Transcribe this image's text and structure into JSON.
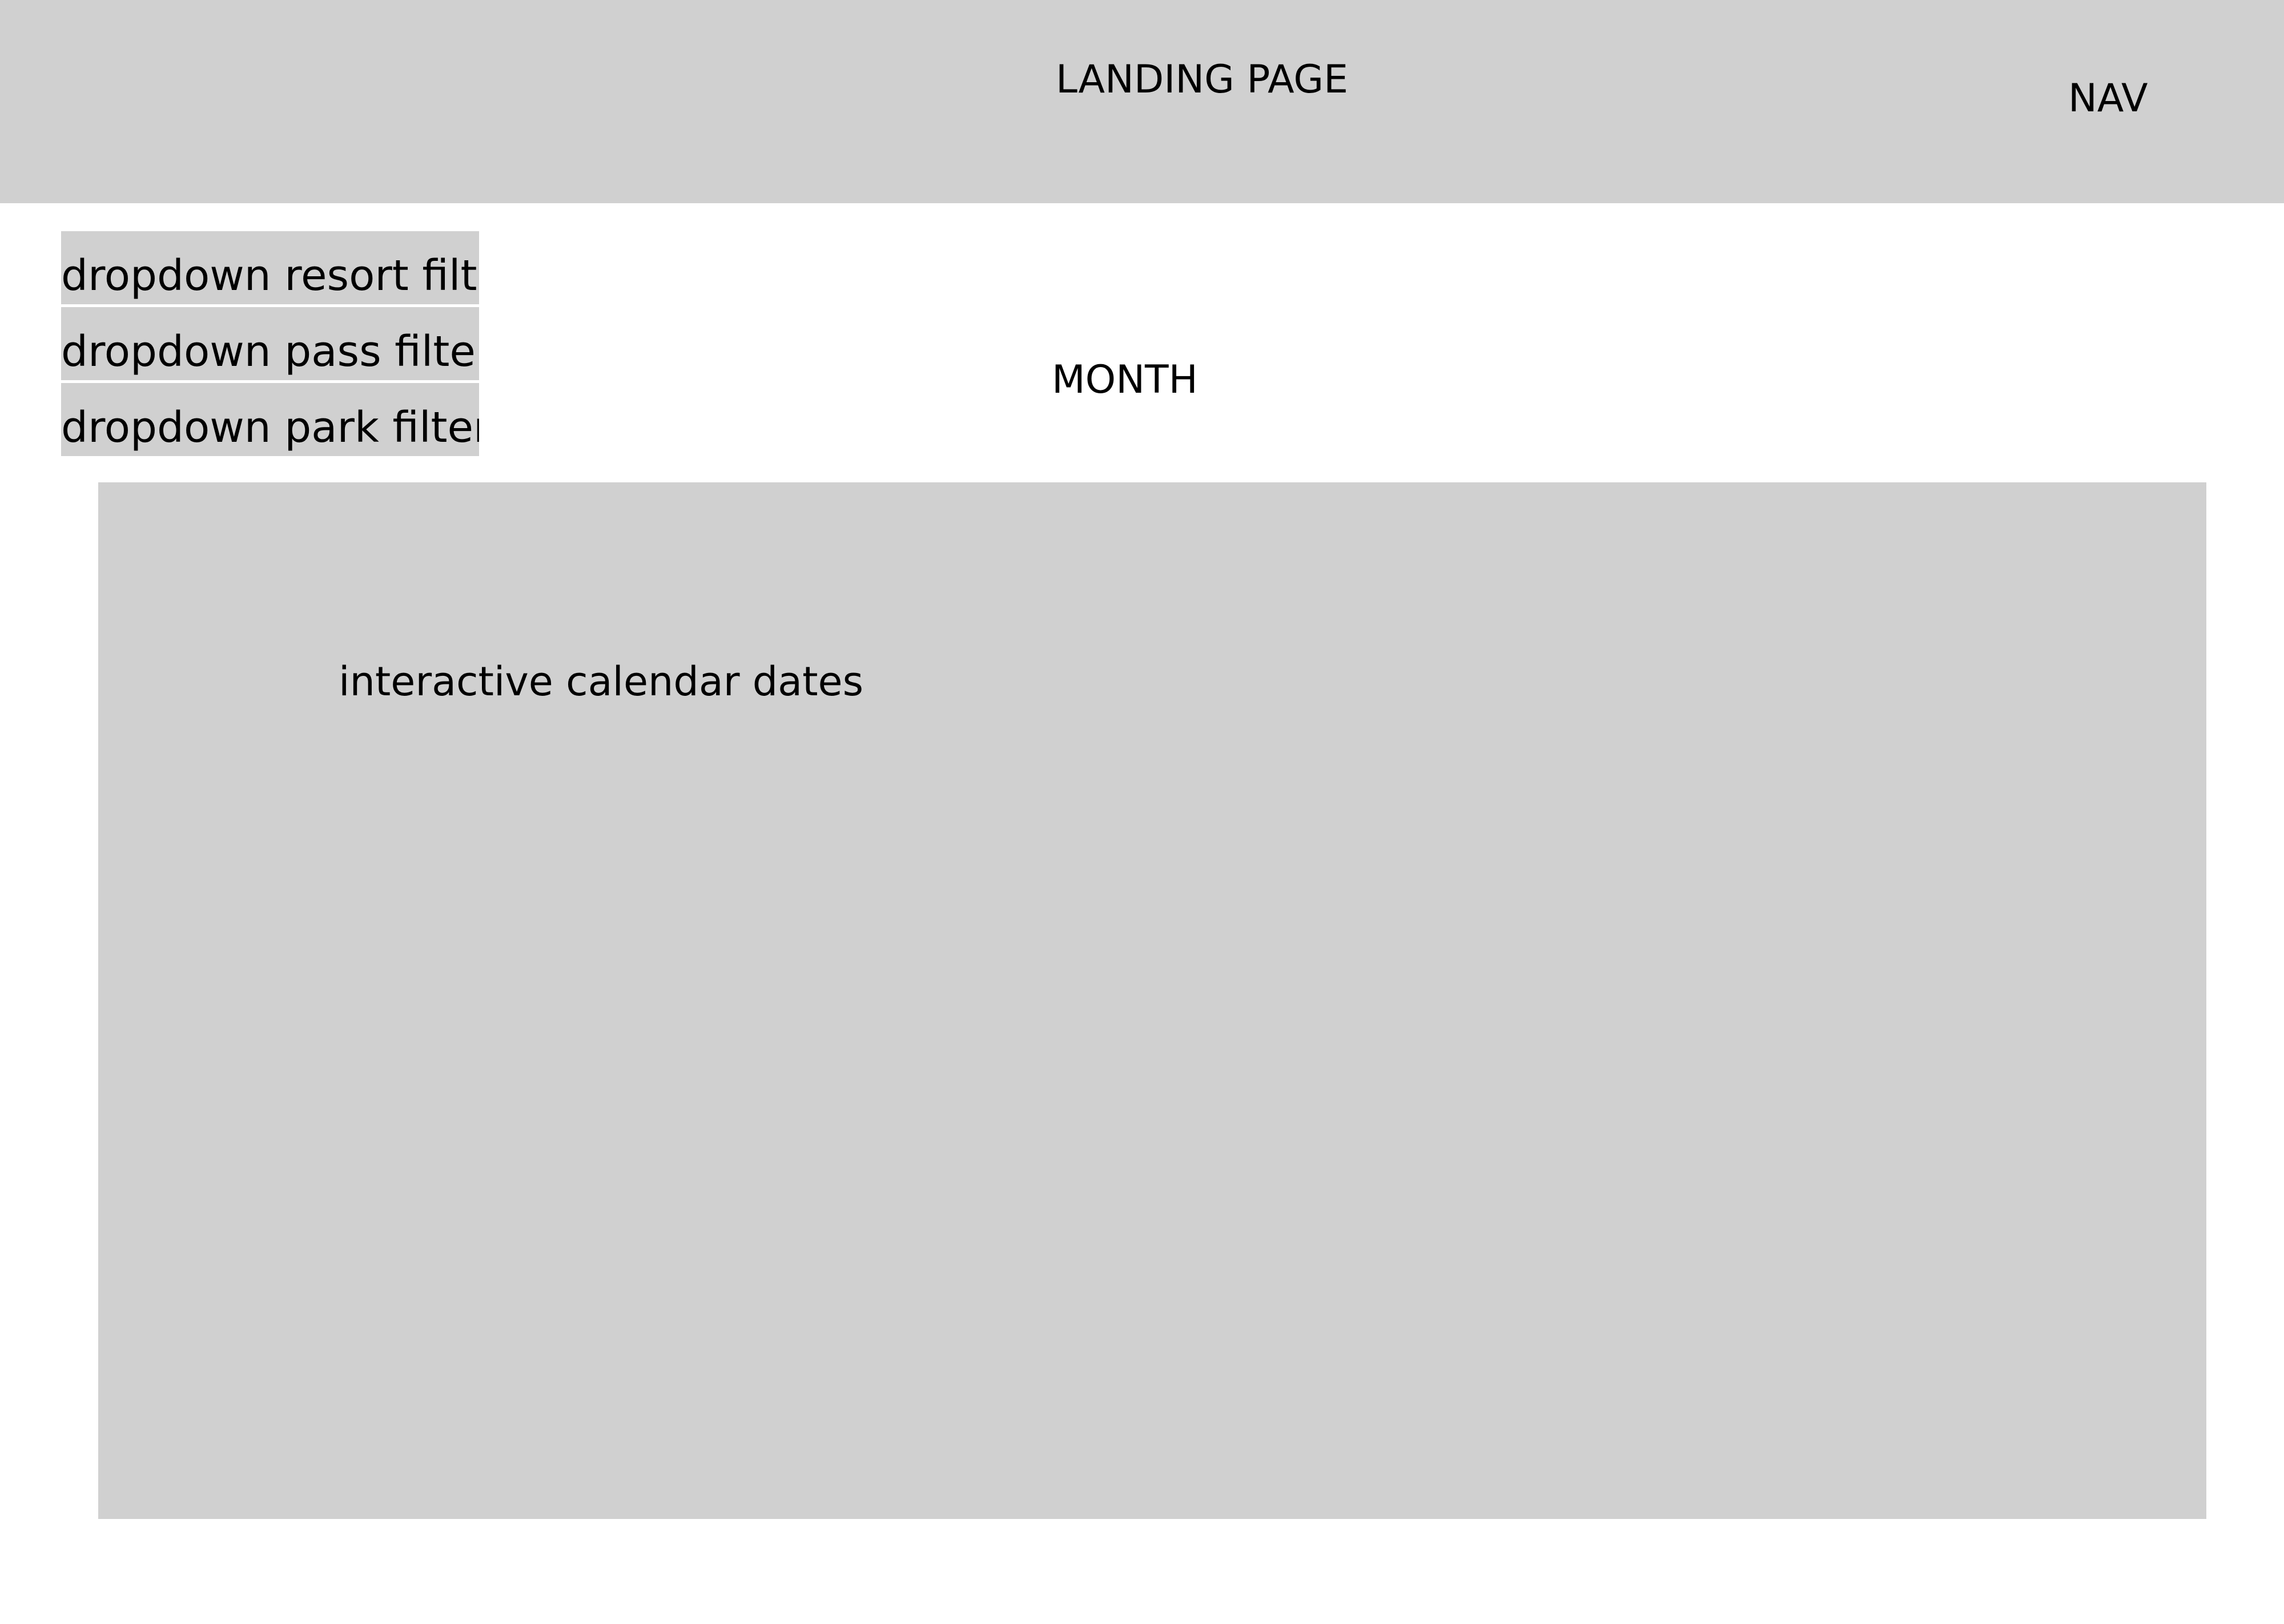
{
  "header": {
    "title": "LANDING PAGE",
    "nav_label": "NAV"
  },
  "filters": [
    {
      "label": "dropdown resort filter"
    },
    {
      "label": "dropdown pass filter"
    },
    {
      "label": "dropdown park filter"
    }
  ],
  "month": {
    "label": "MONTH"
  },
  "calendar": {
    "label": "interactive calendar dates"
  },
  "colors": {
    "placeholder_fill": "#d0d0d0",
    "background": "#ffffff",
    "text": "#000000"
  }
}
